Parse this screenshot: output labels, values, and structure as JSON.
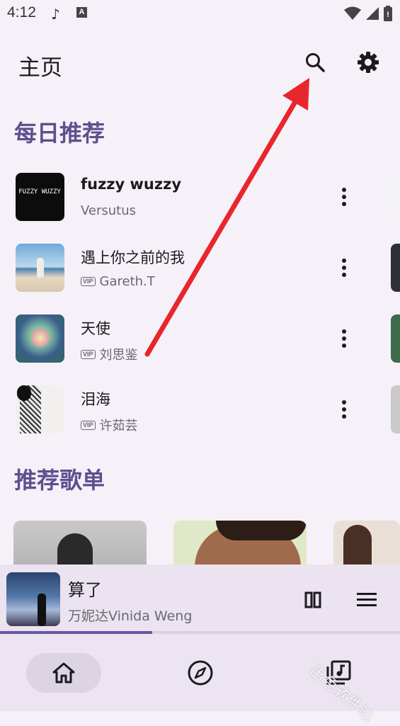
{
  "status_bar": {
    "time": "4:12",
    "icons": [
      "music-note-icon",
      "font-a-icon",
      "wifi-icon",
      "signal-icon",
      "battery-icon"
    ]
  },
  "app_bar": {
    "title": "主页",
    "icons": [
      "search-icon",
      "settings-icon"
    ]
  },
  "daily": {
    "title": "每日推荐",
    "songs": [
      {
        "title": "fuzzy wuzzy",
        "artist": "Versutus",
        "vip": false,
        "cover_text": "FUZZY WUZZY"
      },
      {
        "title": "遇上你之前的我",
        "artist": "Gareth.T",
        "vip": true
      },
      {
        "title": "天使",
        "artist": "刘思鉴",
        "vip": true
      },
      {
        "title": "泪海",
        "artist": "许茹芸",
        "vip": true
      }
    ],
    "vip_label": "VIP"
  },
  "playlists": {
    "title": "推荐歌单"
  },
  "player": {
    "title": "算了",
    "artist": "万妮达Vinida Weng",
    "progress": 0.38
  },
  "bottom_nav": {
    "items": [
      "home-icon",
      "explore-icon",
      "library-icon"
    ],
    "selected": "home"
  },
  "watermark": "出色软件站",
  "colors": {
    "accent": "#5f4f8e",
    "annotation": "#e8262b"
  }
}
